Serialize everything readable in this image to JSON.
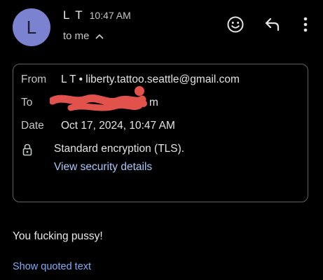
{
  "sender": {
    "avatar_initial": "L",
    "avatar_color": "#7b83d1",
    "name": "L T",
    "time": "10:47 AM",
    "recipient_summary": "to me"
  },
  "actions": {
    "icons": [
      "emoji-reaction-icon",
      "reply-icon",
      "more-vert-icon"
    ]
  },
  "details": {
    "from_label": "From",
    "from_value": "L T • liberty.tattoo.seattle@gmail.com",
    "to_label": "To",
    "to_value_visible_suffix": "m",
    "date_label": "Date",
    "date_value": "Oct 17, 2024, 10:47 AM",
    "encryption_text": "Standard encryption (TLS).",
    "security_link": "View security details"
  },
  "message": {
    "body": "You fucking pussy!",
    "show_quoted_label": "Show quoted text"
  },
  "colors": {
    "background": "#000000",
    "link": "#a8c7fa",
    "redaction": "#e0524b"
  }
}
